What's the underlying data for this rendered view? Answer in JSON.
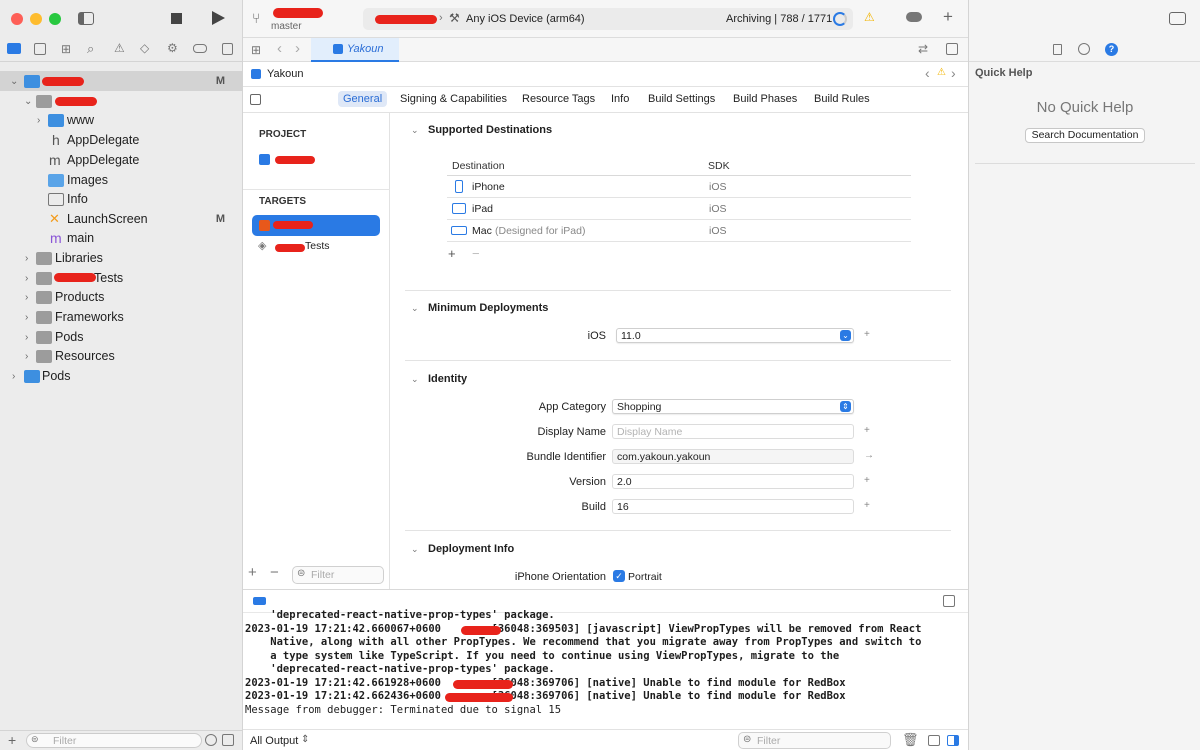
{
  "toolbar": {
    "branch": "master",
    "destination": "Any iOS Device (arm64)",
    "status": "Archiving | 788 / 1771"
  },
  "sidebar": {
    "items": [
      {
        "label": "",
        "badge": "M"
      },
      {
        "label": ""
      },
      {
        "label": "www"
      },
      {
        "label": "AppDelegate",
        "icon_char": "h"
      },
      {
        "label": "AppDelegate",
        "icon_char": "m"
      },
      {
        "label": "Images"
      },
      {
        "label": "Info"
      },
      {
        "label": "LaunchScreen",
        "badge": "M"
      },
      {
        "label": "main",
        "icon_char": "m"
      },
      {
        "label": "Libraries"
      },
      {
        "label": "Tests"
      },
      {
        "label": "Products"
      },
      {
        "label": "Frameworks"
      },
      {
        "label": "Pods"
      },
      {
        "label": "Resources"
      },
      {
        "label": "Pods"
      }
    ],
    "filter_placeholder": "Filter"
  },
  "editor_tab": {
    "label": "Yakoun"
  },
  "jumpbar": {
    "label": "Yakoun"
  },
  "settings_tabs": [
    "General",
    "Signing & Capabilities",
    "Resource Tags",
    "Info",
    "Build Settings",
    "Build Phases",
    "Build Rules"
  ],
  "targets_pane": {
    "project_header": "PROJECT",
    "targets_header": "TARGETS",
    "tests_target": "Tests",
    "filter_placeholder": "Filter"
  },
  "supported_destinations": {
    "title": "Supported Destinations",
    "col_destination": "Destination",
    "col_sdk": "SDK",
    "rows": [
      {
        "name": "iPhone",
        "note": "",
        "sdk": "iOS"
      },
      {
        "name": "iPad",
        "note": "",
        "sdk": "iOS"
      },
      {
        "name": "Mac",
        "note": "(Designed for iPad)",
        "sdk": "iOS"
      }
    ]
  },
  "minimum_deployments": {
    "title": "Minimum Deployments",
    "label": "iOS",
    "value": "11.0"
  },
  "identity": {
    "title": "Identity",
    "app_category_label": "App Category",
    "app_category": "Shopping",
    "display_name_label": "Display Name",
    "display_name_placeholder": "Display Name",
    "bundle_id_label": "Bundle Identifier",
    "bundle_id": "com.yakoun.yakoun",
    "version_label": "Version",
    "version": "2.0",
    "build_label": "Build",
    "build": "16"
  },
  "deployment_info": {
    "title": "Deployment Info",
    "orientation_label": "iPhone Orientation",
    "portrait": "Portrait"
  },
  "console": {
    "lines": [
      "    'deprecated-react-native-prop-types' package.",
      "2023-01-19 17:21:42.660067+0600        [36048:369503] [javascript] ViewPropTypes will be removed from React",
      "    Native, along with all other PropTypes. We recommend that you migrate away from PropTypes and switch to",
      "    a type system like TypeScript. If you need to continue using ViewPropTypes, migrate to the",
      "    'deprecated-react-native-prop-types' package.",
      "2023-01-19 17:21:42.661928+0600        [36048:369706] [native] Unable to find module for RedBox",
      "2023-01-19 17:21:42.662436+0600        [36048:369706] [native] Unable to find module for RedBox",
      "Message from debugger: Terminated due to signal 15"
    ],
    "output_selector": "All Output",
    "filter_placeholder": "Filter"
  },
  "inspector": {
    "title": "Quick Help",
    "empty_text": "No Quick Help",
    "search_button": "Search Documentation"
  },
  "colors": {
    "accent": "#2a7ae4",
    "redaction": "#e8231b",
    "warning": "#f2b400"
  }
}
